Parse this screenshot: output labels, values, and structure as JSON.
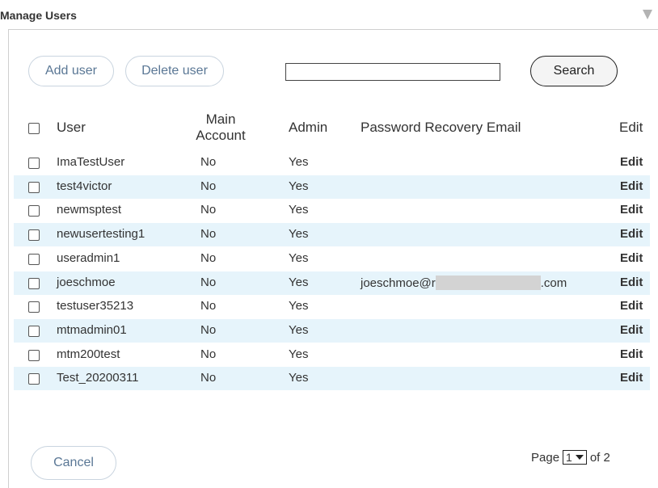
{
  "title": "Manage Users",
  "toolbar": {
    "add_user": "Add user",
    "delete_user": "Delete user",
    "search_value": "",
    "search_label": "Search"
  },
  "table": {
    "headers": {
      "user": "User",
      "main_account": "Main Account",
      "admin": "Admin",
      "recovery_email": "Password Recovery Email",
      "edit": "Edit"
    },
    "rows": [
      {
        "user": "ImaTestUser",
        "main": "No",
        "admin": "Yes",
        "email": "",
        "edit": "Edit"
      },
      {
        "user": "test4victor",
        "main": "No",
        "admin": "Yes",
        "email": "",
        "edit": "Edit"
      },
      {
        "user": "newmsptest",
        "main": "No",
        "admin": "Yes",
        "email": "",
        "edit": "Edit"
      },
      {
        "user": "newusertesting1",
        "main": "No",
        "admin": "Yes",
        "email": "",
        "edit": "Edit"
      },
      {
        "user": "useradmin1",
        "main": "No",
        "admin": "Yes",
        "email": "",
        "edit": "Edit"
      },
      {
        "user": "joeschmoe",
        "main": "No",
        "admin": "Yes",
        "email_prefix": "joeschmoe@r",
        "email_suffix": ".com",
        "edit": "Edit"
      },
      {
        "user": "testuser35213",
        "main": "No",
        "admin": "Yes",
        "email": "",
        "edit": "Edit"
      },
      {
        "user": "mtmadmin01",
        "main": "No",
        "admin": "Yes",
        "email": "",
        "edit": "Edit"
      },
      {
        "user": "mtm200test",
        "main": "No",
        "admin": "Yes",
        "email": "",
        "edit": "Edit"
      },
      {
        "user": "Test_20200311",
        "main": "No",
        "admin": "Yes",
        "email": "",
        "edit": "Edit"
      }
    ]
  },
  "footer": {
    "cancel": "Cancel",
    "page_label": "Page",
    "page_current": "1",
    "page_of": "of 2"
  }
}
